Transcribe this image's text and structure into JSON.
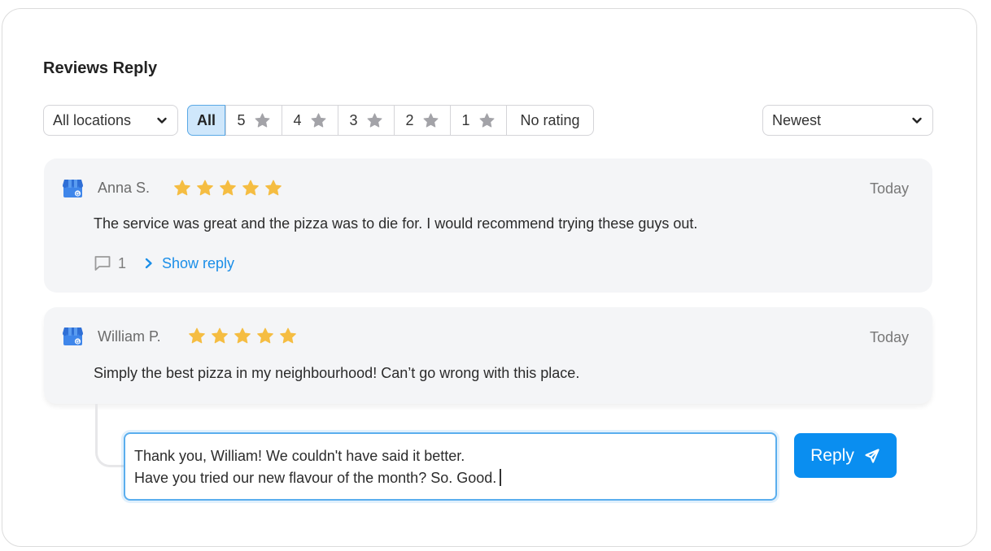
{
  "page": {
    "title": "Reviews Reply"
  },
  "filters": {
    "location_select": {
      "value": "All locations",
      "icon": "chevron-down-icon"
    },
    "rating_segments": [
      {
        "label": "All",
        "active": true,
        "has_star": false
      },
      {
        "label": "5",
        "active": false,
        "has_star": true
      },
      {
        "label": "4",
        "active": false,
        "has_star": true
      },
      {
        "label": "3",
        "active": false,
        "has_star": true
      },
      {
        "label": "2",
        "active": false,
        "has_star": true
      },
      {
        "label": "1",
        "active": false,
        "has_star": true
      },
      {
        "label": "No rating",
        "active": false,
        "has_star": false
      }
    ],
    "sort_select": {
      "value": "Newest",
      "icon": "chevron-down-icon"
    }
  },
  "reviews": [
    {
      "source_icon": "google-my-business-icon",
      "author": "Anna S.",
      "rating": 5,
      "max_rating": 5,
      "date": "Today",
      "text": "The service was great and the pizza was to die for. I would recommend trying these guys out.",
      "reply_count": "1",
      "show_reply_label": "Show reply"
    },
    {
      "source_icon": "google-my-business-icon",
      "author": "William P.",
      "rating": 5,
      "max_rating": 5,
      "date": "Today",
      "text": "Simply the best pizza in my neighbourhood! Can’t go wrong with this place."
    }
  ],
  "reply_editor": {
    "lines": [
      "Thank you, William! We couldn't have said it better.",
      "Have you tried our new flavour of the month? So. Good."
    ],
    "button_label": "Reply",
    "button_icon": "send-icon"
  },
  "colors": {
    "accent": "#0a8ef0",
    "link": "#1a8ee8",
    "star_filled": "#f5bd42",
    "star_muted": "#a3a3a8",
    "active_segment_bg": "#cfe7fb",
    "card_bg": "#f4f5f7"
  }
}
